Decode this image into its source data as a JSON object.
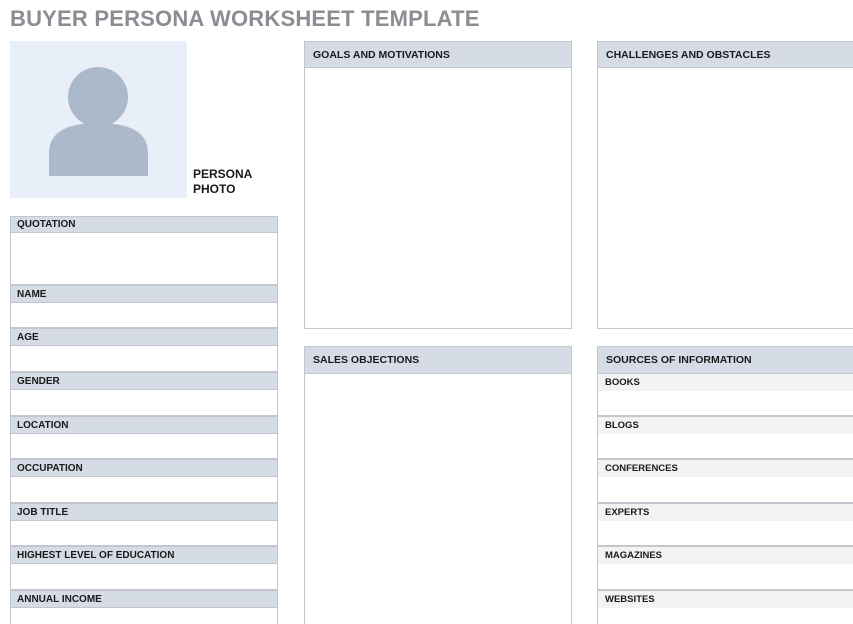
{
  "title": "BUYER PERSONA WORKSHEET TEMPLATE",
  "photo": {
    "label_line1": "PERSONA",
    "label_line2": "PHOTO",
    "icon": "person-silhouette-icon"
  },
  "left_fields": [
    "QUOTATION",
    "NAME",
    "AGE",
    "GENDER",
    "LOCATION",
    "OCCUPATION",
    "JOB TITLE",
    "HIGHEST LEVEL OF EDUCATION",
    "ANNUAL INCOME"
  ],
  "sections": {
    "goals": "GOALS AND MOTIVATIONS",
    "challenges": "CHALLENGES AND OBSTACLES",
    "objections": "SALES OBJECTIONS",
    "sources": "SOURCES OF INFORMATION"
  },
  "sources_items": [
    "BOOKS",
    "BLOGS",
    "CONFERENCES",
    "EXPERTS",
    "MAGAZINES",
    "WEBSITES"
  ],
  "colors": {
    "title": "#8a8d92",
    "header_bg": "#d6dce5",
    "photo_bg": "#e9eff8",
    "silhouette": "#acb9cb",
    "sub_header_bg": "#f3f3f3"
  }
}
